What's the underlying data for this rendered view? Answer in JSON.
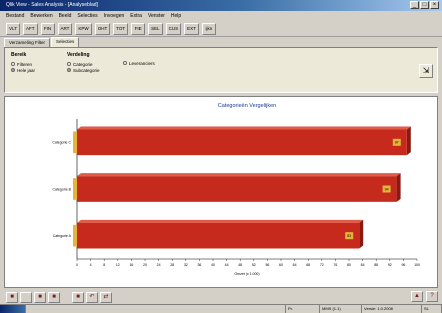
{
  "window": {
    "title": "Qlik View - Sales Analysis - [Analyseblad]"
  },
  "menu": [
    "Bestand",
    "Bewerken",
    "Beeld",
    "Selecties",
    "Invoegen",
    "Extra",
    "Venster",
    "Help"
  ],
  "toolbar": [
    "VLT",
    "AFT",
    "FIN",
    "ART",
    "KPW",
    "OHT",
    "TOT",
    "FIE",
    "SEL",
    "CUS",
    "EXT",
    "ijkn"
  ],
  "tabs": [
    "Verzameling Filter",
    "Selecties"
  ],
  "filters": {
    "group1": {
      "title": "Bereik",
      "options": [
        "Filteren",
        "Hele jaar"
      ]
    },
    "group2": {
      "title": "Verdeling",
      "options": [
        "Categorie",
        "Subcategorie"
      ],
      "extra": "Leveranciers"
    }
  },
  "chart_data": {
    "type": "bar",
    "orientation": "horizontal",
    "title": "Categorieën Vergelijken",
    "categories": [
      "Categorie C",
      "Categorie B",
      "Categorie A"
    ],
    "values": [
      97,
      94,
      83
    ],
    "data_labels": [
      "97",
      "94",
      "83"
    ],
    "xlabel": "Omzet (x 1.000)",
    "xlim": [
      0,
      100
    ],
    "xticks": [
      "0",
      "4",
      "8",
      "12",
      "16",
      "20",
      "24",
      "28",
      "32",
      "36",
      "40",
      "44",
      "48",
      "52",
      "56",
      "60",
      "64",
      "68",
      "72",
      "76",
      "80",
      "84",
      "88",
      "92",
      "96",
      "100"
    ],
    "bar_color": "#c62a1c",
    "label_color": "#e6b43a",
    "grid": false,
    "legend": "none"
  },
  "status": {
    "cells": [
      "",
      "",
      "Pr.",
      "MMS (1.1)",
      "Versie: 1.0.2008",
      "SL"
    ]
  }
}
